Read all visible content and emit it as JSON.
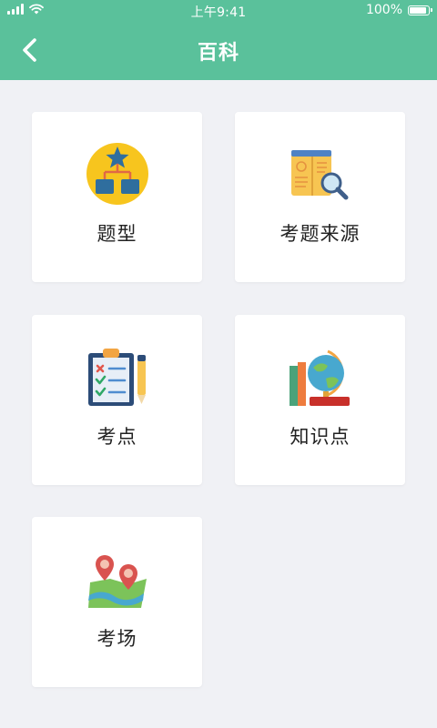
{
  "status_bar": {
    "time": "上午9:41",
    "battery_text": "100%",
    "battery_level": 1.0
  },
  "header": {
    "title": "百科",
    "back_icon": "chevron-left-icon"
  },
  "colors": {
    "header_bg": "#5ac19b",
    "page_bg": "#f0f1f5",
    "card_bg": "#ffffff",
    "text": "#222222"
  },
  "cards": [
    {
      "label": "题型",
      "icon": "hierarchy-star-icon"
    },
    {
      "label": "考题来源",
      "icon": "book-magnifier-icon"
    },
    {
      "label": "考点",
      "icon": "clipboard-checklist-icon"
    },
    {
      "label": "知识点",
      "icon": "globe-books-icon"
    },
    {
      "label": "考场",
      "icon": "map-pins-icon"
    }
  ]
}
